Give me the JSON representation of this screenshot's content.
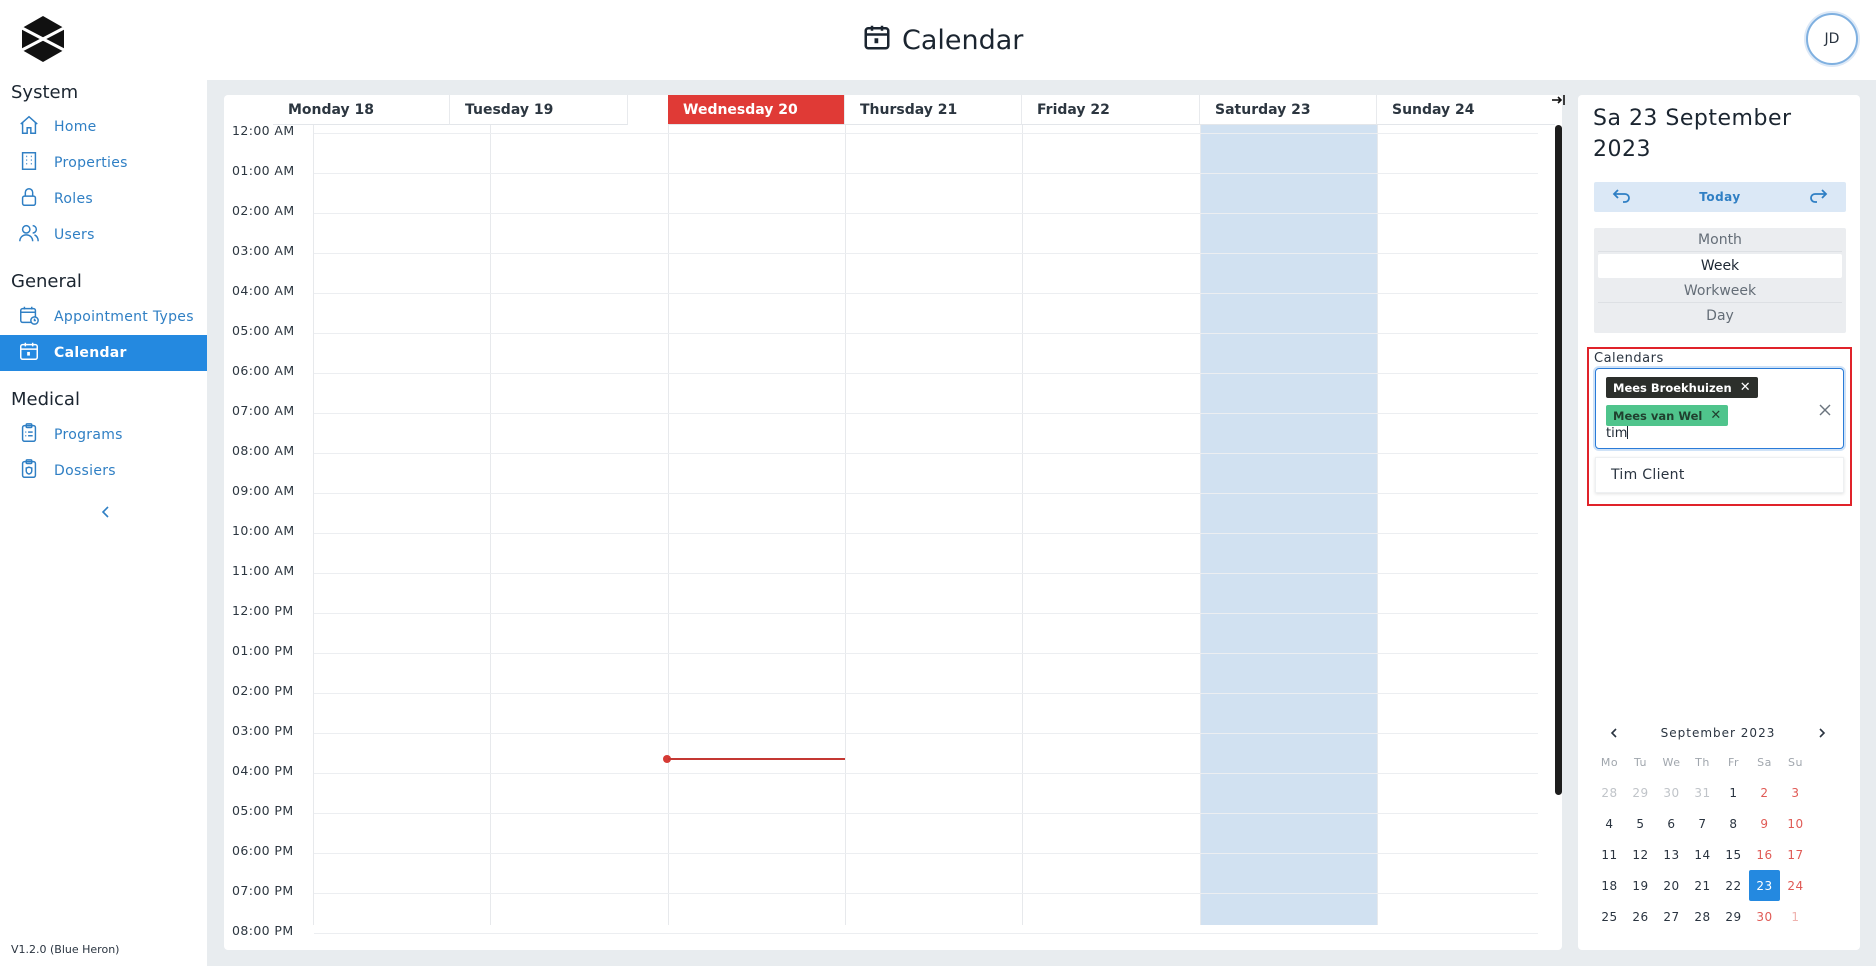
{
  "header": {
    "title": "Calendar",
    "avatar_initials": "JD"
  },
  "sidebar": {
    "sections": [
      {
        "title": "System",
        "items": [
          {
            "label": "Home",
            "icon": "home-icon"
          },
          {
            "label": "Properties",
            "icon": "building-icon"
          },
          {
            "label": "Roles",
            "icon": "lock-icon"
          },
          {
            "label": "Users",
            "icon": "users-icon"
          }
        ]
      },
      {
        "title": "General",
        "items": [
          {
            "label": "Appointment Types",
            "icon": "calendar-clock-icon"
          },
          {
            "label": "Calendar",
            "icon": "calendar-icon",
            "active": true
          }
        ]
      },
      {
        "title": "Medical",
        "items": [
          {
            "label": "Programs",
            "icon": "clipboard-icon"
          },
          {
            "label": "Dossiers",
            "icon": "clipboard-shield-icon"
          }
        ]
      }
    ],
    "version": "V1.2.0 (Blue Heron)"
  },
  "week": {
    "days": [
      {
        "label": "Monday 18",
        "today": false,
        "weekend_highlight": false
      },
      {
        "label": "Tuesday 19",
        "today": false,
        "weekend_highlight": false
      },
      {
        "label": "Wednesday 20",
        "today": true,
        "weekend_highlight": false
      },
      {
        "label": "Thursday 21",
        "today": false,
        "weekend_highlight": false
      },
      {
        "label": "Friday 22",
        "today": false,
        "weekend_highlight": false
      },
      {
        "label": "Saturday 23",
        "today": false,
        "weekend_highlight": true
      },
      {
        "label": "Sunday 24",
        "today": false,
        "weekend_highlight": false
      }
    ],
    "times": [
      "12:00 AM",
      "01:00 AM",
      "02:00 AM",
      "03:00 AM",
      "04:00 AM",
      "05:00 AM",
      "06:00 AM",
      "07:00 AM",
      "08:00 AM",
      "09:00 AM",
      "10:00 AM",
      "11:00 AM",
      "12:00 PM",
      "01:00 PM",
      "02:00 PM",
      "03:00 PM",
      "04:00 PM",
      "05:00 PM",
      "06:00 PM",
      "07:00 PM",
      "08:00 PM"
    ],
    "current_time_hours": 15.8
  },
  "panel": {
    "date_title": "Sa 23 September 2023",
    "today_label": "Today",
    "views": [
      {
        "label": "Month",
        "active": false
      },
      {
        "label": "Week",
        "active": true
      },
      {
        "label": "Workweek",
        "active": false
      },
      {
        "label": "Day",
        "active": false
      }
    ],
    "calendars_label": "Calendars",
    "chips": [
      "Mees Broekhuizen",
      "Mees van Wel"
    ],
    "search_value": "tim",
    "options": [
      "Tim  Client"
    ]
  },
  "mini_calendar": {
    "month_label": "September 2023",
    "weekdays": [
      "Mo",
      "Tu",
      "We",
      "Th",
      "Fr",
      "Sa",
      "Su"
    ],
    "weeks": [
      [
        {
          "d": "28",
          "m": true
        },
        {
          "d": "29",
          "m": true
        },
        {
          "d": "30",
          "m": true
        },
        {
          "d": "31",
          "m": true
        },
        {
          "d": "1"
        },
        {
          "d": "2",
          "w": true
        },
        {
          "d": "3",
          "w": true
        }
      ],
      [
        {
          "d": "4"
        },
        {
          "d": "5"
        },
        {
          "d": "6"
        },
        {
          "d": "7"
        },
        {
          "d": "8"
        },
        {
          "d": "9",
          "w": true
        },
        {
          "d": "10",
          "w": true
        }
      ],
      [
        {
          "d": "11"
        },
        {
          "d": "12"
        },
        {
          "d": "13"
        },
        {
          "d": "14"
        },
        {
          "d": "15"
        },
        {
          "d": "16",
          "w": true
        },
        {
          "d": "17",
          "w": true
        }
      ],
      [
        {
          "d": "18"
        },
        {
          "d": "19"
        },
        {
          "d": "20"
        },
        {
          "d": "21"
        },
        {
          "d": "22"
        },
        {
          "d": "23",
          "s": true
        },
        {
          "d": "24",
          "w": true
        }
      ],
      [
        {
          "d": "25"
        },
        {
          "d": "26"
        },
        {
          "d": "27"
        },
        {
          "d": "28"
        },
        {
          "d": "29"
        },
        {
          "d": "30",
          "w": true
        },
        {
          "d": "1",
          "m": true,
          "w": true
        }
      ]
    ]
  }
}
